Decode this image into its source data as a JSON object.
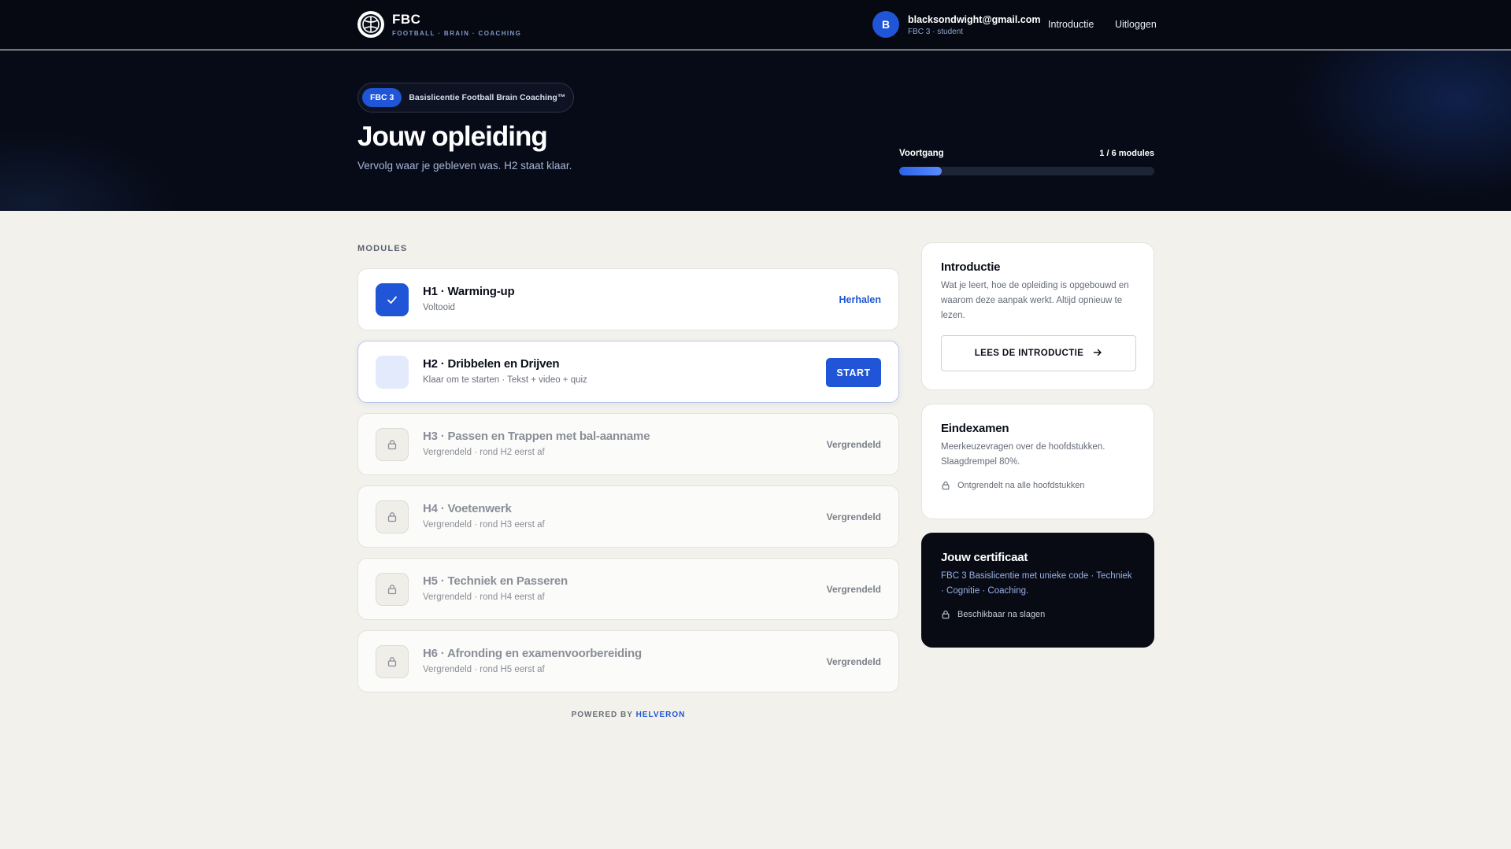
{
  "nav": {
    "brand_title": "FBC",
    "brand_subtitle": "FOOTBALL · BRAIN · COACHING",
    "user_initial": "B",
    "user_email": "blacksondwight@gmail.com",
    "user_role": "FBC 3 · student",
    "intro_link": "Introductie",
    "logout_link": "Uitloggen"
  },
  "hero": {
    "badge": "FBC 3",
    "badge_text": "Basislicentie Football Brain Coaching™",
    "title": "Jouw opleiding",
    "subtitle": "Vervolg waar je gebleven was. H2 staat klaar.",
    "progress_label": "Voortgang",
    "progress_text": "1 / 6 modules",
    "progress_done": 1,
    "progress_total": 6
  },
  "modules_label": "MODULES",
  "modules": [
    {
      "title": "H1 · Warming-up",
      "subtitle": "Voltooid",
      "action": "Herhalen",
      "state": "done"
    },
    {
      "title": "H2 · Dribbelen en Drijven",
      "subtitle": "Klaar om te starten · Tekst + video + quiz",
      "action": "START",
      "state": "ready"
    },
    {
      "title": "H3 · Passen en Trappen met bal-aanname",
      "subtitle": "Vergrendeld · rond H2 eerst af",
      "action": "Vergrendeld",
      "state": "locked"
    },
    {
      "title": "H4 · Voetenwerk",
      "subtitle": "Vergrendeld · rond H3 eerst af",
      "action": "Vergrendeld",
      "state": "locked"
    },
    {
      "title": "H5 · Techniek en Passeren",
      "subtitle": "Vergrendeld · rond H4 eerst af",
      "action": "Vergrendeld",
      "state": "locked"
    },
    {
      "title": "H6 · Afronding en examenvoorbereiding",
      "subtitle": "Vergrendeld · rond H5 eerst af",
      "action": "Vergrendeld",
      "state": "locked"
    }
  ],
  "footer": {
    "powered_by": "POWERED BY",
    "powered_brand": "HELVERON"
  },
  "sidebar": {
    "intro": {
      "title": "Introductie",
      "text": "Wat je leert, hoe de opleiding is opgebouwd en waarom deze aanpak werkt. Altijd opnieuw te lezen.",
      "button": "LEES DE INTRODUCTIE"
    },
    "exam": {
      "title": "Eindexamen",
      "text": "Meerkeuzevragen over de hoofdstukken. Slaagdrempel 80%.",
      "note": "Ontgrendelt na alle hoofdstukken"
    },
    "certificate": {
      "title": "Jouw certificaat",
      "text": "FBC 3 Basislicentie met unieke code · Techniek · Cognitie · Coaching.",
      "note": "Beschikbaar na slagen"
    }
  },
  "colors": {
    "accent": "#1f55d6",
    "nav_bg": "#060912",
    "page_bg": "#f3f1ec"
  }
}
